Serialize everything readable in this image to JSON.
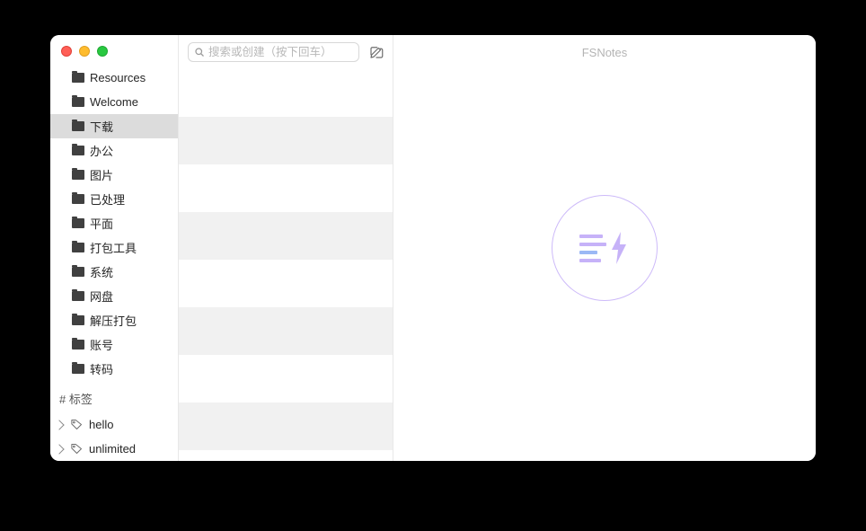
{
  "app_title": "FSNotes",
  "search": {
    "placeholder": "搜索或创建（按下回车）"
  },
  "folders": [
    {
      "label": "Resources",
      "selected": false
    },
    {
      "label": "Welcome",
      "selected": false
    },
    {
      "label": "下载",
      "selected": true
    },
    {
      "label": "办公",
      "selected": false
    },
    {
      "label": "图片",
      "selected": false
    },
    {
      "label": "已处理",
      "selected": false
    },
    {
      "label": "平面",
      "selected": false
    },
    {
      "label": "打包工具",
      "selected": false
    },
    {
      "label": "系统",
      "selected": false
    },
    {
      "label": "网盘",
      "selected": false
    },
    {
      "label": "解压打包",
      "selected": false
    },
    {
      "label": "账号",
      "selected": false
    },
    {
      "label": "转码",
      "selected": false
    }
  ],
  "tags_header": "# 标签",
  "tags": [
    {
      "label": "hello"
    },
    {
      "label": "unlimited"
    }
  ]
}
